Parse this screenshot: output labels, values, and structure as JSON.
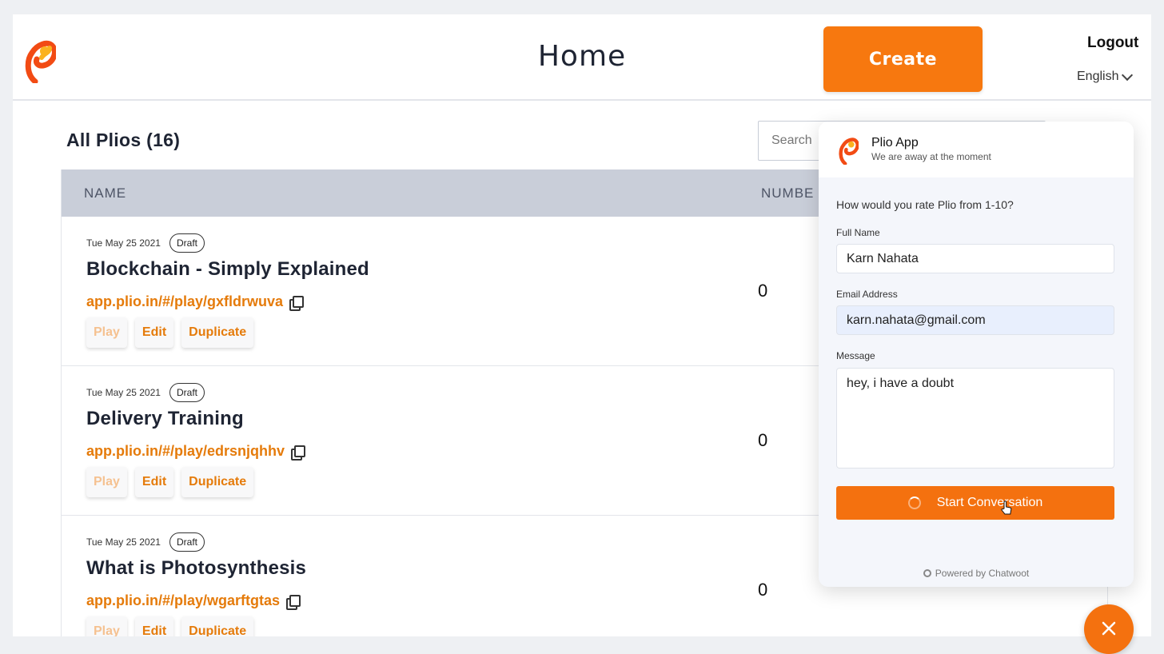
{
  "header": {
    "title": "Home",
    "create_label": "Create",
    "logout_label": "Logout",
    "language": "English"
  },
  "list": {
    "heading": "All Plios (16)",
    "search_placeholder": "Search",
    "columns": [
      "NAME",
      "NUMBE"
    ],
    "rows": [
      {
        "date": "Tue May 25 2021",
        "status": "Draft",
        "title": "Blockchain - Simply Explained",
        "link": "app.plio.in/#/play/gxfldrwuva",
        "count": "0",
        "actions": {
          "play": "Play",
          "edit": "Edit",
          "duplicate": "Duplicate"
        }
      },
      {
        "date": "Tue May 25 2021",
        "status": "Draft",
        "title": "Delivery Training",
        "link": "app.plio.in/#/play/edrsnjqhhv",
        "count": "0",
        "actions": {
          "play": "Play",
          "edit": "Edit",
          "duplicate": "Duplicate"
        }
      },
      {
        "date": "Tue May 25 2021",
        "status": "Draft",
        "title": "What is Photosynthesis",
        "link": "app.plio.in/#/play/wgarftgtas",
        "count": "0",
        "actions": {
          "play": "Play",
          "edit": "Edit",
          "duplicate": "Duplicate"
        }
      }
    ]
  },
  "chat": {
    "app_name": "Plio App",
    "status": "We are away at the moment",
    "question": "How would you rate Plio from 1-10?",
    "full_name_label": "Full Name",
    "full_name_value": "Karn Nahata",
    "email_label": "Email Address",
    "email_value": "karn.nahata@gmail.com",
    "message_label": "Message",
    "message_value": "hey, i have a doubt",
    "start_label": "Start Conversation",
    "powered_by": "Powered by Chatwoot"
  },
  "colors": {
    "brand_orange": "#f7780f",
    "link_orange": "#e57b0b",
    "table_header": "#c9ced9"
  },
  "icons": [
    "plio-logo-icon",
    "chevron-down-icon",
    "copy-icon",
    "spinner-icon",
    "hand-cursor-icon",
    "chatwoot-icon",
    "close-icon"
  ]
}
